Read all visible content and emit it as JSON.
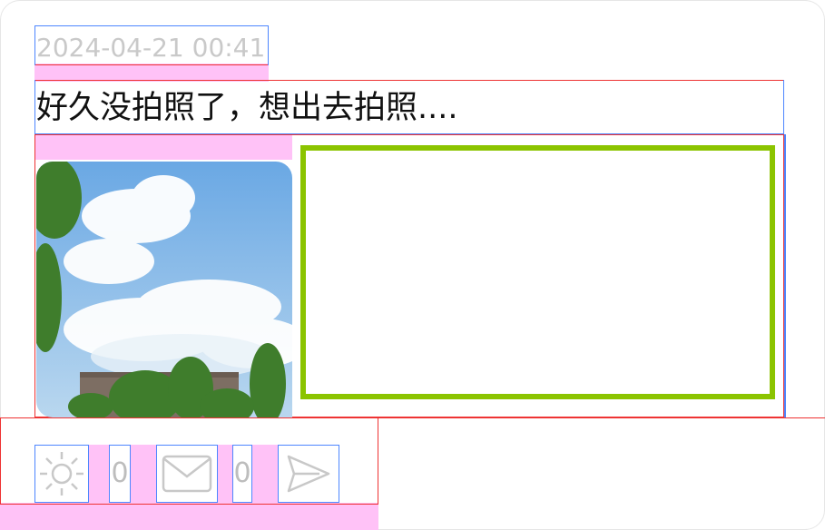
{
  "post": {
    "timestamp": "2024-04-21 00:41",
    "text": "好久没拍照了，想出去拍照....",
    "image_alt": "sky-with-clouds-and-trees"
  },
  "actions": {
    "like_count": "0",
    "comment_count": "0"
  },
  "colors": {
    "timestamp": "#c9c9c9",
    "text": "#111111",
    "icon": "#c8c8c8",
    "highlight": "#8bc400",
    "overlay_red": "#ee3333",
    "overlay_blue": "#4d86ff",
    "overlay_pink": "#ffc2f7"
  },
  "icons": [
    "sun-like-icon",
    "mail-comment-icon",
    "send-share-icon"
  ]
}
